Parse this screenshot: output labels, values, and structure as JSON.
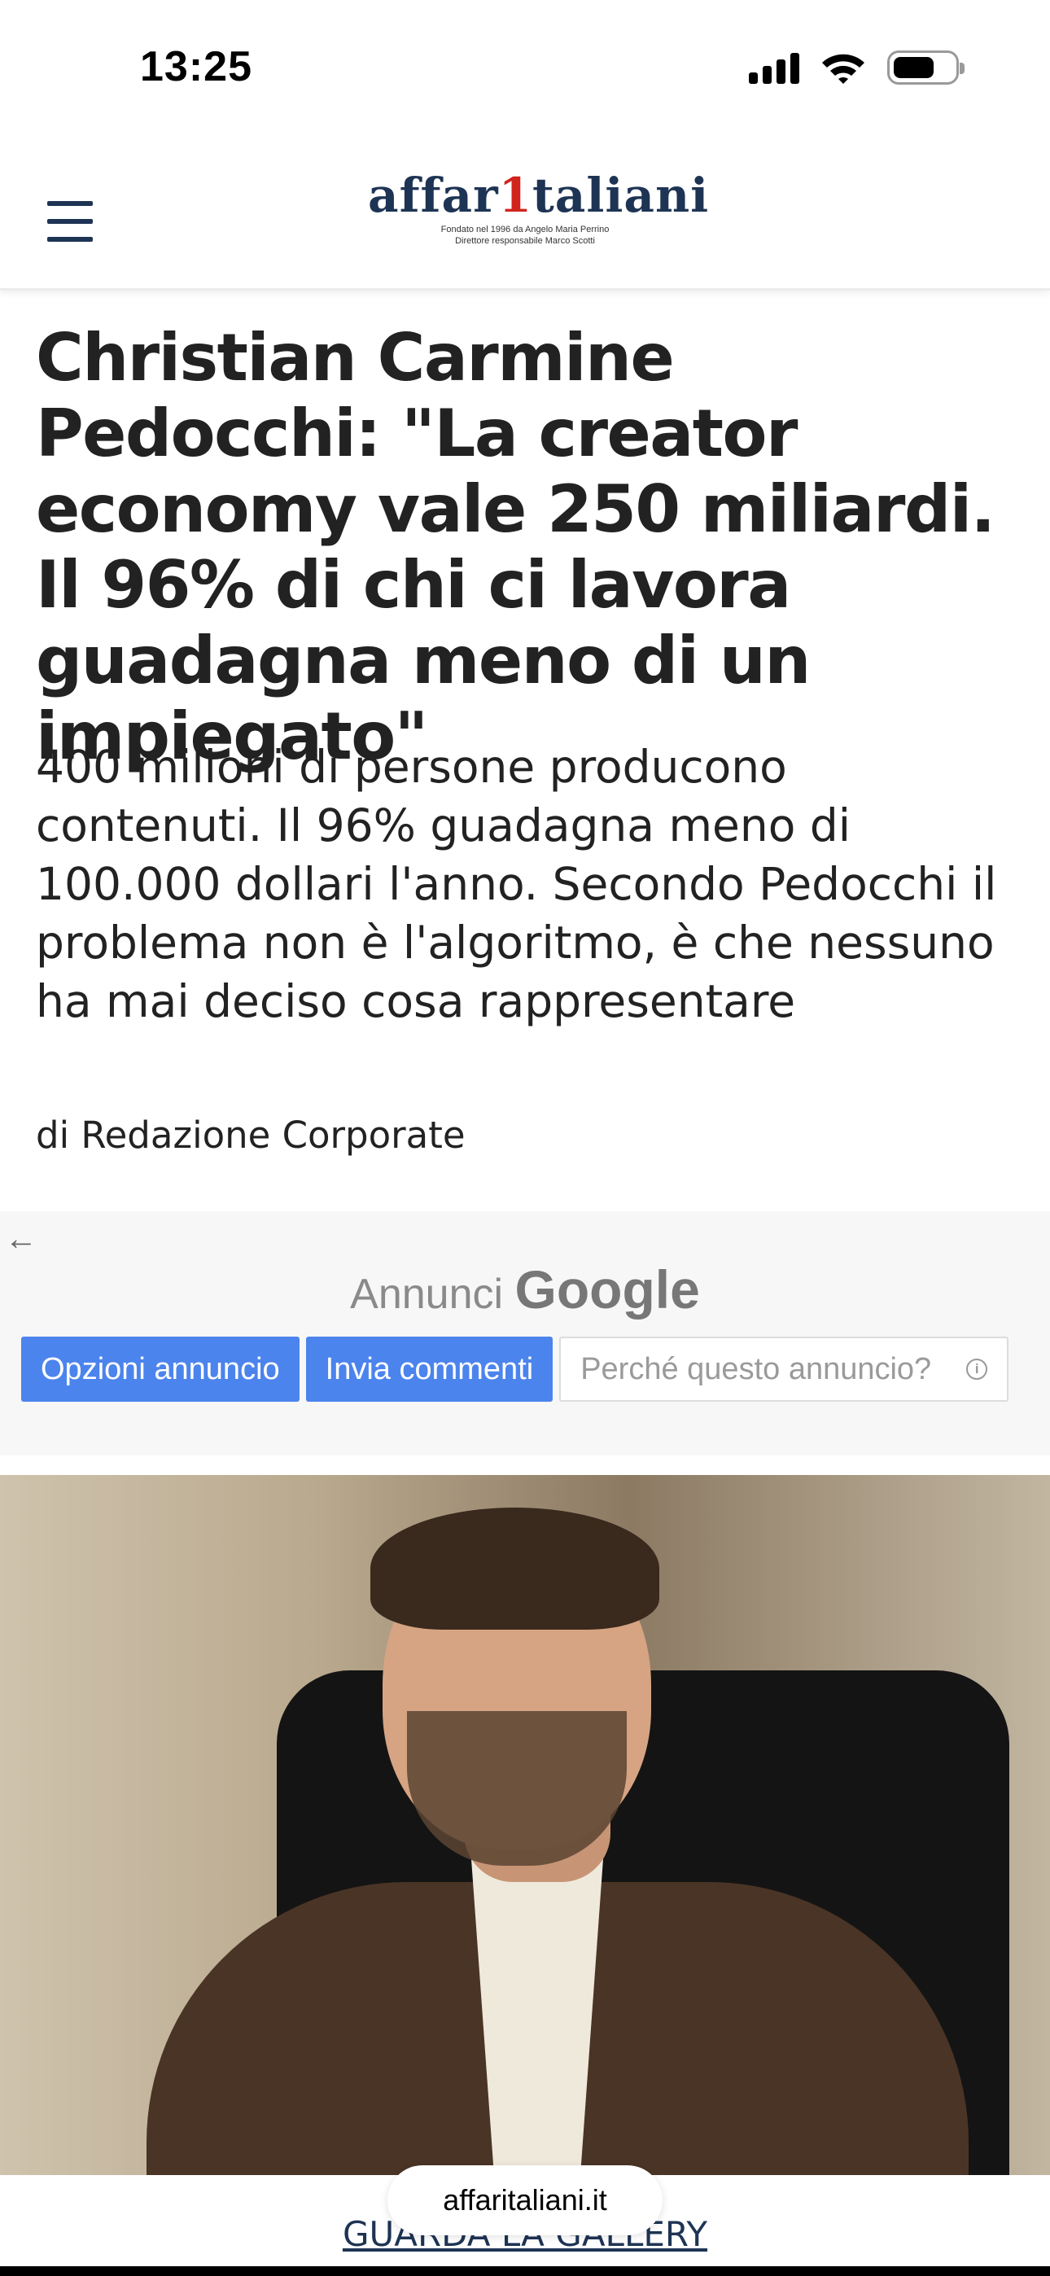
{
  "status_bar": {
    "time": "13:25",
    "icons": [
      "cellular-signal-icon",
      "wifi-icon",
      "battery-icon"
    ]
  },
  "header": {
    "logo": {
      "prefix": "affar",
      "accent": "1",
      "suffix": "taliani",
      "line1": "Fondato nel 1996 da Angelo Maria Perrino",
      "line2": "Direttore responsabile Marco Scotti"
    },
    "menu_icon": "hamburger-menu-icon"
  },
  "article": {
    "headline": "Christian Carmine Pedocchi: \"La creator economy vale 250 miliardi. Il 96% di chi ci lavora guadagna meno di un impiegato\"",
    "subtitle": "400 milioni di persone producono contenuti. Il 96% guadagna meno di 100.000 dollari l'anno. Secondo Pedocchi il problema non è l'algoritmo, è che nessuno ha mai deciso cosa rappresentare",
    "byline": "di Redazione Corporate"
  },
  "ad": {
    "label": "Annunci",
    "brand": "Google",
    "buttons": {
      "options": "Opzioni annuncio",
      "feedback": "Invia commenti",
      "why": "Perché questo annuncio?"
    }
  },
  "gallery": {
    "link_label": "GUARDA LA GALLERY"
  },
  "browser": {
    "url": "affaritaliani.it"
  },
  "colors": {
    "brand_navy": "#1e3454",
    "brand_red": "#d0241c",
    "ad_button_blue": "#4c84ed"
  }
}
